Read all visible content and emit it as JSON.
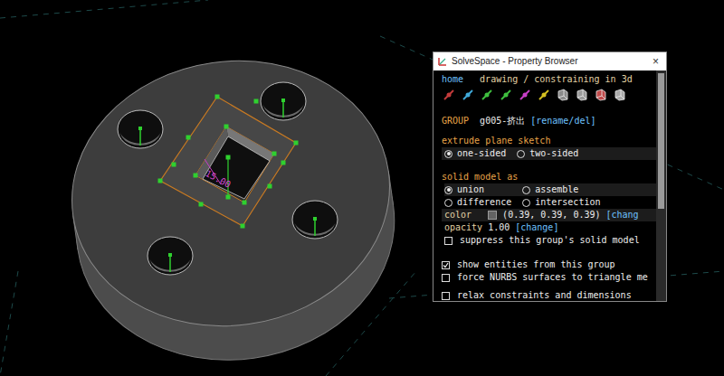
{
  "canvas": {
    "dimension_label": "15.00"
  },
  "window": {
    "title": "SolveSpace - Property Browser",
    "close": "×"
  },
  "nav": {
    "home": "home",
    "context": "drawing / constraining in 3d"
  },
  "group": {
    "label": "GROUP",
    "name": "g005-挤出",
    "action": "[rename/del]"
  },
  "extrude": {
    "heading": "extrude plane sketch",
    "options": [
      {
        "label": "one-sided",
        "selected": true
      },
      {
        "label": "two-sided",
        "selected": false
      }
    ]
  },
  "solid_model": {
    "heading": "solid model as",
    "options": [
      {
        "label": "union",
        "selected": true
      },
      {
        "label": "assemble",
        "selected": false
      },
      {
        "label": "difference",
        "selected": false
      },
      {
        "label": "intersection",
        "selected": false
      }
    ]
  },
  "color": {
    "label": "color",
    "swatch": "#636363",
    "value": "(0.39, 0.39, 0.39)",
    "action": "[chang"
  },
  "opacity": {
    "label": "opacity",
    "value": "1.00",
    "action": "[change]"
  },
  "checkboxes": [
    {
      "label": "suppress this group's solid model",
      "checked": false
    },
    {
      "label": "show entities from this group",
      "checked": true
    },
    {
      "label": "force NURBS surfaces to triangle me",
      "checked": false
    },
    {
      "label": "relax constraints and dimensions",
      "checked": false
    }
  ]
}
